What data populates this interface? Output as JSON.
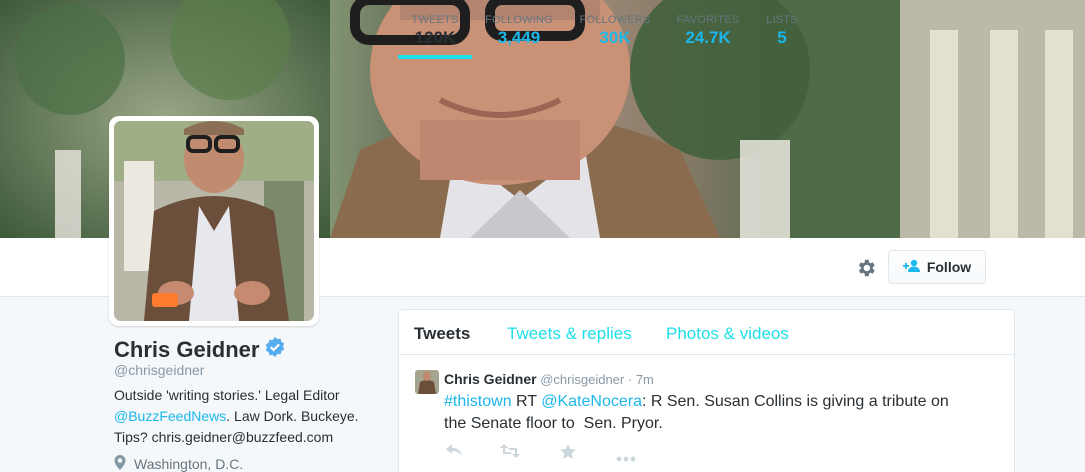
{
  "profile": {
    "name": "Chris Geidner",
    "handle": "@chrisgeidner",
    "bio": {
      "line1": "Outside 'writing stories.' Legal Editor",
      "mention": "@BuzzFeedNews",
      "line2_rest": ". Law Dork. Buckeye.",
      "line3": "Tips? chris.geidner@buzzfeed.com"
    },
    "location": "Washington, D.C."
  },
  "stats": [
    {
      "label": "TWEETS",
      "value": "120K"
    },
    {
      "label": "FOLLOWING",
      "value": "3,449"
    },
    {
      "label": "FOLLOWERS",
      "value": "30K"
    },
    {
      "label": "FAVORITES",
      "value": "24.7K"
    },
    {
      "label": "LISTS",
      "value": "5"
    }
  ],
  "follow_button": {
    "label": "Follow"
  },
  "tabs": [
    "Tweets",
    "Tweets & replies",
    "Photos & videos"
  ],
  "tweet": {
    "name": "Chris Geidner",
    "handle": "@chrisgeidner",
    "separator": "·",
    "time": "7m",
    "hashtag": "#thistown",
    "rt": " RT ",
    "mention": "@KateNocera",
    "text_line1": ": R Sen. Susan Collins is giving a tribute on",
    "text_line2": "the Senate floor to  Sen. Pryor."
  },
  "colors": {
    "accent": "#1cb7eb",
    "active_tab_underline": "#1cdfe8",
    "verified": "#55acee"
  },
  "icons": {
    "verified": "verified-badge-icon",
    "gear": "gear-icon",
    "follow": "person-plus-icon",
    "location": "location-pin-icon",
    "reply": "reply-icon",
    "retweet": "retweet-icon",
    "favorite": "star-icon",
    "more": "more-icon"
  }
}
